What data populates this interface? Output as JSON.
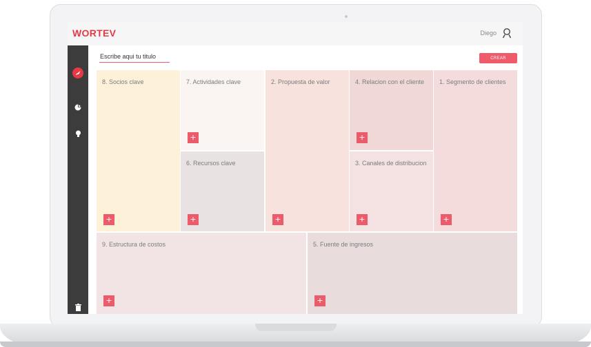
{
  "header": {
    "logo": "WORTEV",
    "user_name": "Diego"
  },
  "sidebar": {
    "items": [
      {
        "icon": "rocket-icon"
      },
      {
        "icon": "pie-chart-icon"
      },
      {
        "icon": "bulb-icon"
      },
      {
        "icon": "trash-icon"
      }
    ]
  },
  "toolbar": {
    "title_placeholder": "Escribe aqui tu titulo",
    "create_label": "CREAR"
  },
  "canvas": {
    "add_symbol": "+",
    "blocks": {
      "socios": "8. Socios clave",
      "actividades": "7. Actividades clave",
      "recursos": "6. Recursos clave",
      "propuesta": "2. Propuesta de valor",
      "relacion": "4. Relacion con el cliente",
      "canales": "3. Canales de distribucion",
      "segmento": "1. Segmento de clientes",
      "costos": "9. Estructura de costos",
      "ingresos": "5. Fuente de ingresos"
    }
  },
  "colors": {
    "brand": "#e63946",
    "button": "#ec5b6b",
    "sidebar": "#3c3c3c"
  }
}
